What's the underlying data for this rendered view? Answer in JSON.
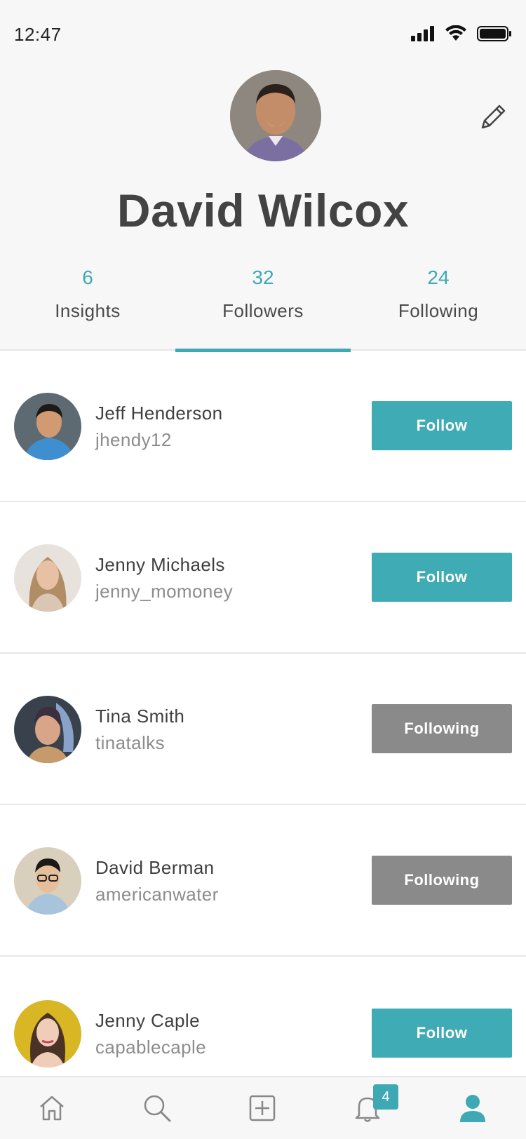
{
  "status_bar": {
    "time": "12:47"
  },
  "profile": {
    "name": "David Wilcox"
  },
  "tabs": [
    {
      "count": "6",
      "label": "Insights",
      "active": false
    },
    {
      "count": "32",
      "label": "Followers",
      "active": true
    },
    {
      "count": "24",
      "label": "Following",
      "active": false
    }
  ],
  "followers": [
    {
      "name": "Jeff Henderson",
      "handle": "jhendy12",
      "button": "Follow",
      "state": "follow"
    },
    {
      "name": "Jenny Michaels",
      "handle": "jenny_momoney",
      "button": "Follow",
      "state": "follow"
    },
    {
      "name": "Tina Smith",
      "handle": "tinatalks",
      "button": "Following",
      "state": "following"
    },
    {
      "name": "David Berman",
      "handle": "americanwater",
      "button": "Following",
      "state": "following"
    },
    {
      "name": "Jenny Caple",
      "handle": "capablecaple",
      "button": "Follow",
      "state": "follow"
    }
  ],
  "tab_bar": {
    "items": [
      "home-icon",
      "search-icon",
      "add-icon",
      "bell-icon",
      "profile-icon"
    ],
    "notification_badge": "4"
  },
  "colors": {
    "accent": "#3ea8b4",
    "following_gray": "#8a8a8a",
    "background": "#f7f7f7"
  }
}
